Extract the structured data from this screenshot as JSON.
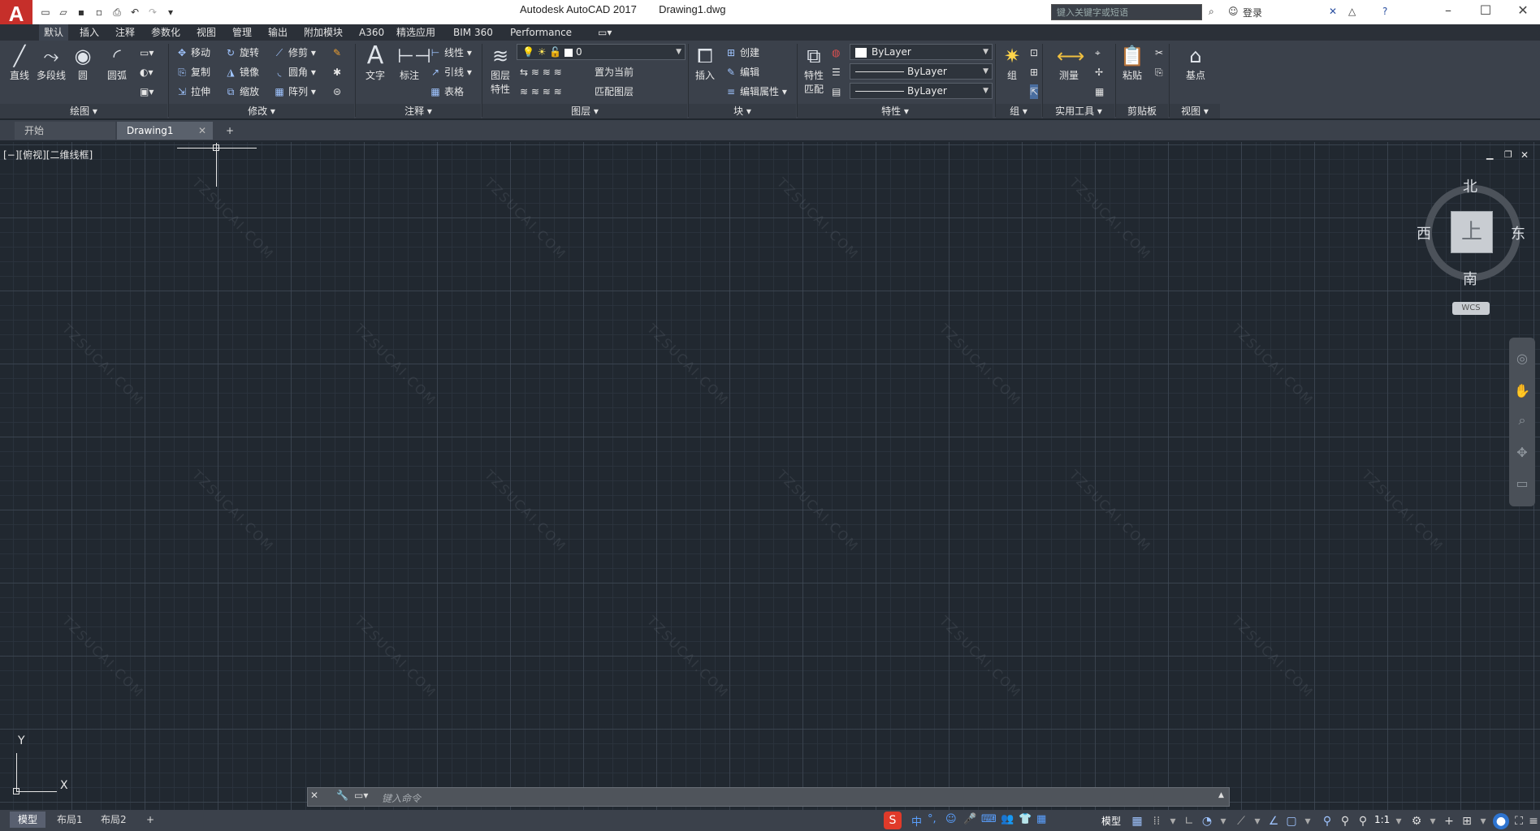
{
  "app": {
    "logo": "A",
    "title": "Autodesk AutoCAD 2017",
    "file": "Drawing1.dwg"
  },
  "titlebar": {
    "search_placeholder": "键入关键字或短语",
    "login": "登录"
  },
  "menu_tabs": [
    "默认",
    "插入",
    "注释",
    "参数化",
    "视图",
    "管理",
    "输出",
    "附加模块",
    "A360",
    "精选应用",
    "BIM 360",
    "Performance"
  ],
  "ribbon": {
    "draw": {
      "title": "绘图",
      "line": "直线",
      "polyline": "多段线",
      "circle": "圆",
      "arc": "圆弧"
    },
    "modify": {
      "title": "修改",
      "move": "移动",
      "rotate": "旋转",
      "trim": "修剪",
      "copy": "复制",
      "mirror": "镜像",
      "fillet": "圆角",
      "stretch": "拉伸",
      "scale": "缩放",
      "array": "阵列"
    },
    "annotation": {
      "title": "注释",
      "text": "文字",
      "dimension": "标注",
      "linear": "线性",
      "leader": "引线",
      "table": "表格"
    },
    "layers": {
      "title": "图层",
      "properties_l1": "图层",
      "properties_l2": "特性",
      "current_layer": "0",
      "make_current": "置为当前",
      "match_layer": "匹配图层"
    },
    "block": {
      "title": "块",
      "insert": "插入",
      "create": "创建",
      "edit": "编辑",
      "edit_attr": "编辑属性"
    },
    "properties": {
      "title": "特性",
      "match_l1": "特性",
      "match_l2": "匹配",
      "color": "ByLayer",
      "linetype": "ByLayer",
      "lineweight": "ByLayer"
    },
    "groups": {
      "title": "组",
      "group": "组"
    },
    "utilities": {
      "title": "实用工具",
      "measure": "测量"
    },
    "clipboard": {
      "title": "剪贴板",
      "paste": "粘贴"
    },
    "view": {
      "title": "视图",
      "base": "基点"
    }
  },
  "file_tabs": {
    "start": "开始",
    "drawing": "Drawing1"
  },
  "viewport": {
    "label": "[−][俯视][二维线框]",
    "watermark": "TZSUCAI.COM"
  },
  "viewcube": {
    "north": "北",
    "south": "南",
    "east": "东",
    "west": "西",
    "top": "上",
    "wcs": "WCS"
  },
  "ucs": {
    "x": "X",
    "y": "Y"
  },
  "command": {
    "placeholder": "键入命令"
  },
  "layout_tabs": [
    "模型",
    "布局1",
    "布局2"
  ],
  "status": {
    "model": "模型",
    "scale": "1:1",
    "ime": "中"
  }
}
